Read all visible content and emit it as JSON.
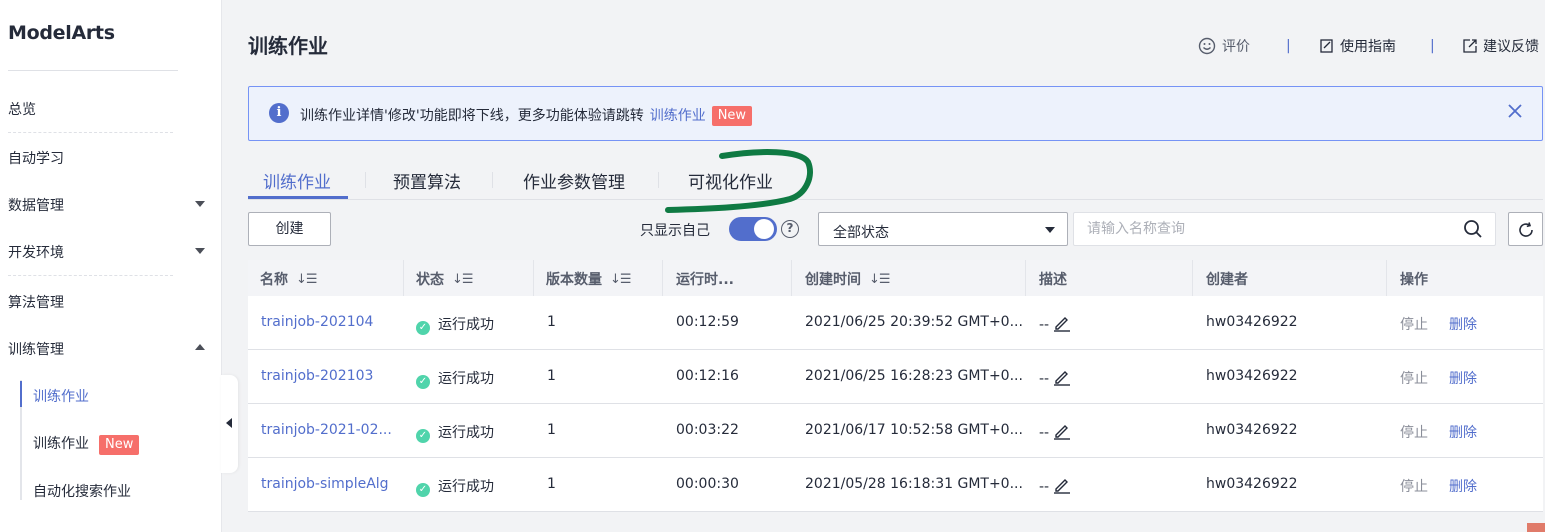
{
  "sidebar": {
    "brand": "ModelArts",
    "items": [
      {
        "label": "总览"
      },
      {
        "label": "自动学习"
      },
      {
        "label": "数据管理"
      },
      {
        "label": "开发环境"
      },
      {
        "label": "算法管理"
      },
      {
        "label": "训练管理"
      }
    ],
    "sub_items": [
      {
        "label": "训练作业"
      },
      {
        "label": "训练作业",
        "badge": "New"
      },
      {
        "label": "自动化搜索作业"
      }
    ]
  },
  "header": {
    "title": "训练作业",
    "links": {
      "rate": "评价",
      "guide": "使用指南",
      "feedback": "建议反馈"
    },
    "separator": "|"
  },
  "alert": {
    "message": "训练作业详情'修改'功能即将下线，更多功能体验请跳转",
    "link": "训练作业",
    "badge": "New"
  },
  "tabs": [
    {
      "label": "训练作业"
    },
    {
      "label": "预置算法"
    },
    {
      "label": "作业参数管理"
    },
    {
      "label": "可视化作业"
    }
  ],
  "toolbar": {
    "create_label": "创建",
    "only_mine_label": "只显示自己",
    "only_mine_on": true,
    "help": "?",
    "status_select": "全部状态",
    "search_placeholder": "请输入名称查询"
  },
  "table": {
    "columns": [
      "名称",
      "状态",
      "版本数量",
      "运行时...",
      "创建时间",
      "描述",
      "创建者",
      "操作"
    ],
    "sort_glyph": "↓☰",
    "rows": [
      {
        "name": "trainjob-202104",
        "status": "运行成功",
        "versions": "1",
        "runtime": "00:12:59",
        "created": "2021/06/25 20:39:52 GMT+0...",
        "desc": "--",
        "creator": "hw03426922",
        "stop": "停止",
        "delete": "删除"
      },
      {
        "name": "trainjob-202103",
        "status": "运行成功",
        "versions": "1",
        "runtime": "00:12:16",
        "created": "2021/06/25 16:28:23 GMT+0...",
        "desc": "--",
        "creator": "hw03426922",
        "stop": "停止",
        "delete": "删除"
      },
      {
        "name": "trainjob-2021-02...",
        "status": "运行成功",
        "versions": "1",
        "runtime": "00:03:22",
        "created": "2021/06/17 10:52:58 GMT+0...",
        "desc": "--",
        "creator": "hw03426922",
        "stop": "停止",
        "delete": "删除"
      },
      {
        "name": "trainjob-simpleAlg",
        "status": "运行成功",
        "versions": "1",
        "runtime": "00:00:30",
        "created": "2021/05/28 16:18:31 GMT+0...",
        "desc": "--",
        "creator": "hw03426922",
        "stop": "停止",
        "delete": "删除"
      }
    ]
  },
  "colors": {
    "accent": "#526ecc",
    "success": "#50d4ab",
    "new_badge": "#f66f6a",
    "annotation": "#0f7a43"
  }
}
